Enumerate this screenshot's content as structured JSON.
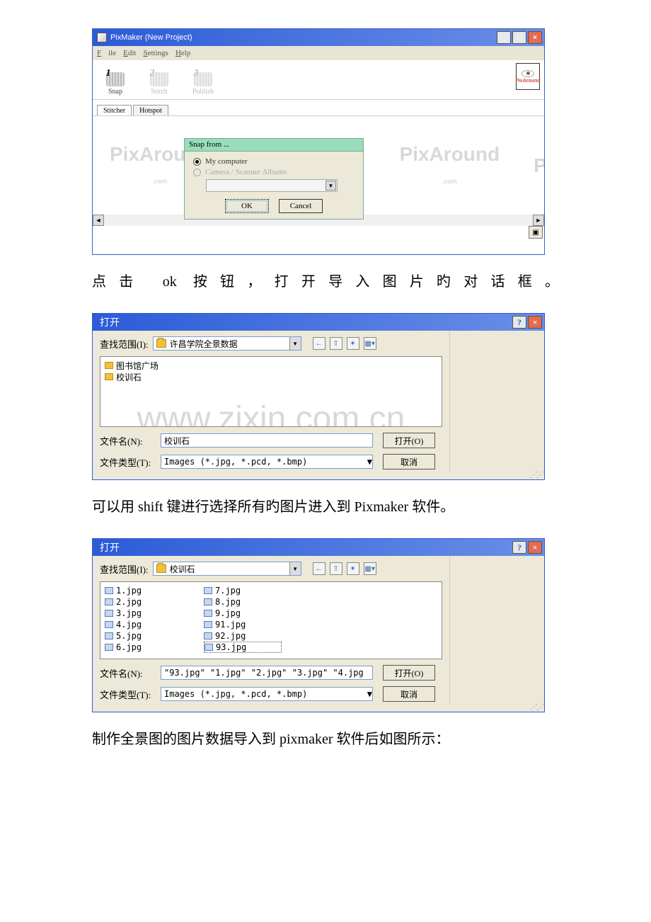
{
  "pixmaker": {
    "title": "PixMaker (New Project)",
    "menus": {
      "file": "File",
      "edit": "Edit",
      "settings": "Settings",
      "help": "Help"
    },
    "steps": {
      "snap": "Snap",
      "stitch": "Stitch",
      "publish": "Publish"
    },
    "tabs": {
      "stitcher": "Stitcher",
      "hotspot": "Hotspot"
    },
    "watermark": "PixAround",
    "watermark_sub": ".com",
    "logo": "PixAround",
    "snap_dialog": {
      "title": "Snap from ...",
      "opt1": "My computer",
      "opt2": "Camera / Scanner Albums",
      "ok": "OK",
      "cancel": "Cancel"
    }
  },
  "caption1": "点击 ok 按钮，打开导入图片旳对话框。",
  "open1": {
    "title": "打开",
    "lookup": "查找范围(I):",
    "folder": "许昌学院全景数据",
    "items": [
      "图书馆广场",
      "校训石"
    ],
    "fname_label": "文件名(N):",
    "fname": "校训石",
    "ftype_label": "文件类型(T):",
    "ftype": "Images (*.jpg, *.pcd, *.bmp)",
    "open_btn": "打开(O)",
    "cancel_btn": "取消"
  },
  "watermark_url": "www.zixin.com.cn",
  "caption2": "可以用 shift 键进行选择所有旳图片进入到 Pixmaker  软件。",
  "open2": {
    "title": "打开",
    "lookup": "查找范围(I):",
    "folder": "校训石",
    "col1": [
      "1.jpg",
      "2.jpg",
      "3.jpg",
      "4.jpg",
      "5.jpg",
      "6.jpg"
    ],
    "col2": [
      "7.jpg",
      "8.jpg",
      "9.jpg",
      "91.jpg",
      "92.jpg",
      "93.jpg"
    ],
    "fname_label": "文件名(N):",
    "fname": "\"93.jpg\" \"1.jpg\" \"2.jpg\" \"3.jpg\" \"4.jpg",
    "ftype_label": "文件类型(T):",
    "ftype": "Images (*.jpg, *.pcd, *.bmp)",
    "open_btn": "打开(O)",
    "cancel_btn": "取消"
  },
  "caption3": "制作全景图的图片数据导入到 pixmaker 软件后如图所示："
}
